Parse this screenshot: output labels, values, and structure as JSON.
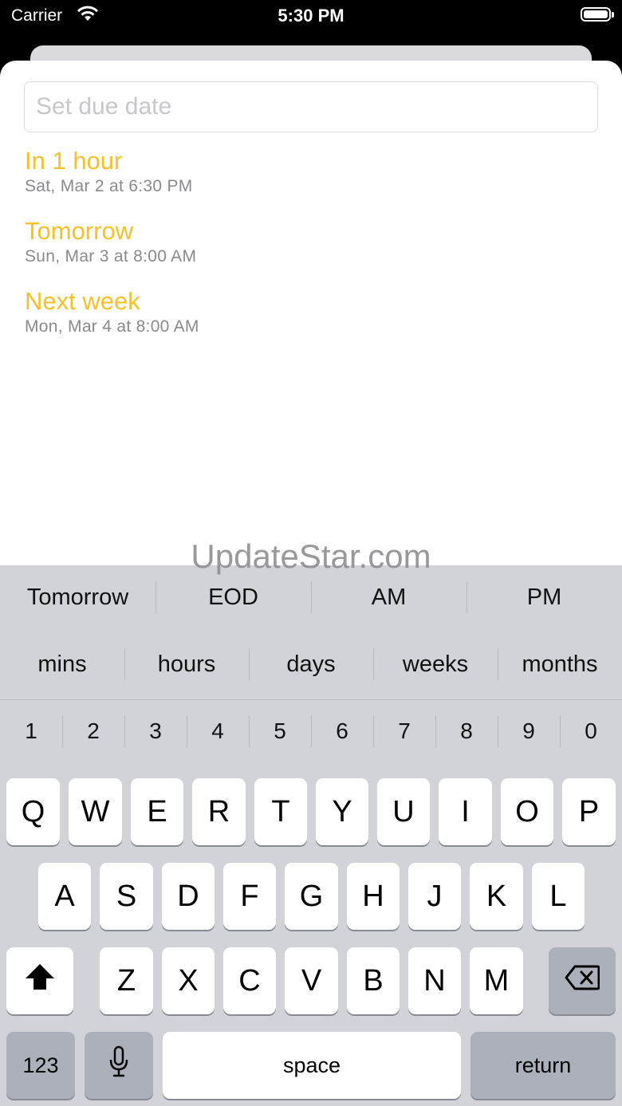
{
  "status_bar": {
    "carrier": "Carrier",
    "time": "5:30 PM"
  },
  "due_date": {
    "placeholder": "Set due date",
    "options": [
      {
        "title": "In 1 hour",
        "subtitle": "Sat, Mar 2 at 6:30 PM"
      },
      {
        "title": "Tomorrow",
        "subtitle": "Sun, Mar 3 at 8:00 AM"
      },
      {
        "title": "Next week",
        "subtitle": "Mon, Mar 4 at 8:00 AM"
      }
    ]
  },
  "watermark": "UpdateStar.com",
  "keyboard": {
    "suggestions_row1": [
      "Tomorrow",
      "EOD",
      "AM",
      "PM"
    ],
    "suggestions_row2": [
      "mins",
      "hours",
      "days",
      "weeks",
      "months"
    ],
    "numbers": [
      "1",
      "2",
      "3",
      "4",
      "5",
      "6",
      "7",
      "8",
      "9",
      "0"
    ],
    "letters_row1": [
      "Q",
      "W",
      "E",
      "R",
      "T",
      "Y",
      "U",
      "I",
      "O",
      "P"
    ],
    "letters_row2": [
      "A",
      "S",
      "D",
      "F",
      "G",
      "H",
      "J",
      "K",
      "L"
    ],
    "letters_row3": [
      "Z",
      "X",
      "C",
      "V",
      "B",
      "N",
      "M"
    ],
    "numbers_key": "123",
    "space_key": "space",
    "return_key": "return"
  }
}
